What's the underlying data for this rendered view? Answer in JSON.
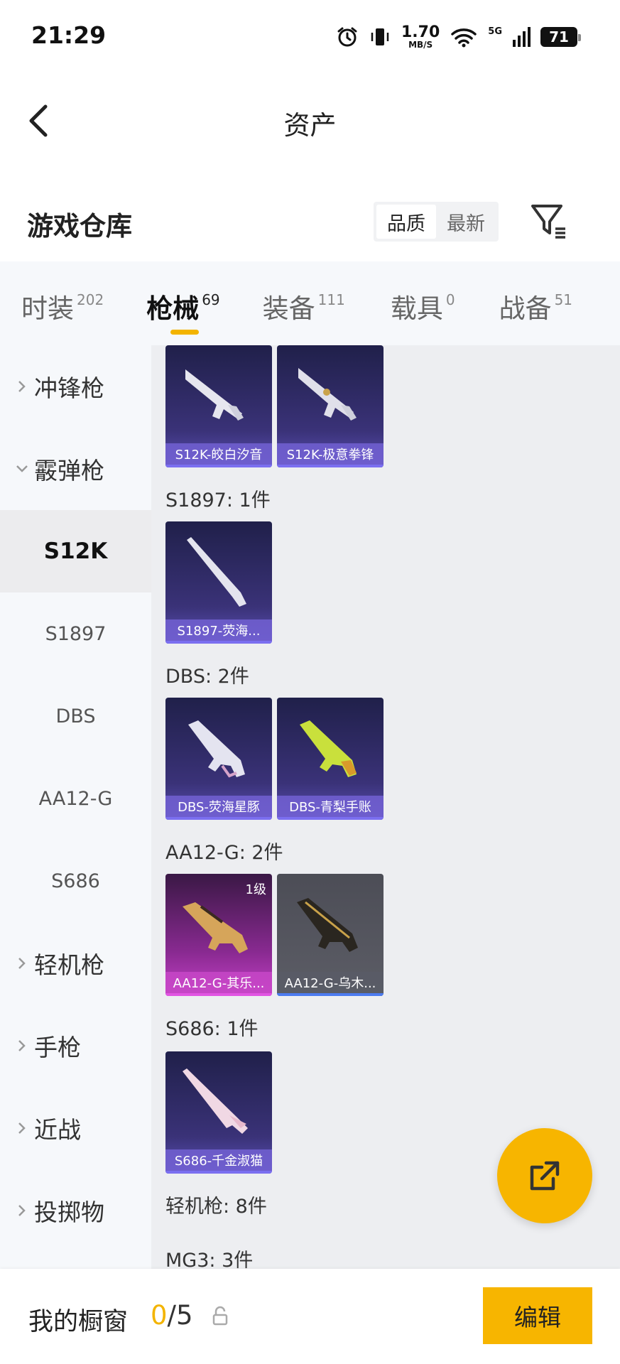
{
  "status_bar": {
    "time": "21:29",
    "net_speed": "1.70",
    "net_unit": "MB/S",
    "signal": "5G",
    "battery": "71"
  },
  "header": {
    "title": "资产"
  },
  "warehouse": {
    "title": "游戏仓库",
    "sort_options": [
      "品质",
      "最新"
    ],
    "sort_active": "品质"
  },
  "tabs": [
    {
      "label": "时装",
      "count": "202"
    },
    {
      "label": "枪械",
      "count": "69",
      "active": true
    },
    {
      "label": "装备",
      "count": "111"
    },
    {
      "label": "载具",
      "count": "0"
    },
    {
      "label": "战备",
      "count": "51"
    }
  ],
  "sidebar": [
    {
      "label": "冲锋枪",
      "type": "group",
      "expanded": false
    },
    {
      "label": "霰弹枪",
      "type": "group",
      "expanded": true
    },
    {
      "label": "S12K",
      "type": "sub",
      "active": true
    },
    {
      "label": "S1897",
      "type": "sub"
    },
    {
      "label": "DBS",
      "type": "sub"
    },
    {
      "label": "AA12-G",
      "type": "sub"
    },
    {
      "label": "S686",
      "type": "sub"
    },
    {
      "label": "轻机枪",
      "type": "group",
      "expanded": false
    },
    {
      "label": "手枪",
      "type": "group",
      "expanded": false
    },
    {
      "label": "近战",
      "type": "group",
      "expanded": false
    },
    {
      "label": "投掷物",
      "type": "group",
      "expanded": false
    }
  ],
  "items": {
    "s12k": [
      {
        "name": "S12K-皎白汐音"
      },
      {
        "name": "S12K-极意拳锋"
      }
    ],
    "s1897_label": "S1897: 1件",
    "s1897": [
      {
        "name": "S1897-荧海..."
      }
    ],
    "dbs_label": "DBS: 2件",
    "dbs": [
      {
        "name": "DBS-荧海星豚"
      },
      {
        "name": "DBS-青梨手账"
      }
    ],
    "aa12_label": "AA12-G: 2件",
    "aa12": [
      {
        "name": "AA12-G-其乐...",
        "level": "1级"
      },
      {
        "name": "AA12-G-乌木..."
      }
    ],
    "s686_label": "S686: 1件",
    "s686": [
      {
        "name": "S686-千金淑猫"
      }
    ],
    "lmg_label": "轻机枪: 8件",
    "mg3_label": "MG3: 3件"
  },
  "bottom": {
    "label": "我的橱窗",
    "count_current": "0",
    "count_sep_total": "/5",
    "edit": "编辑"
  },
  "colors": {
    "accent": "#f7b500",
    "purple_card": "#3a3278",
    "pink_card": "#c541c6",
    "gray_card": "#5c5d66"
  }
}
